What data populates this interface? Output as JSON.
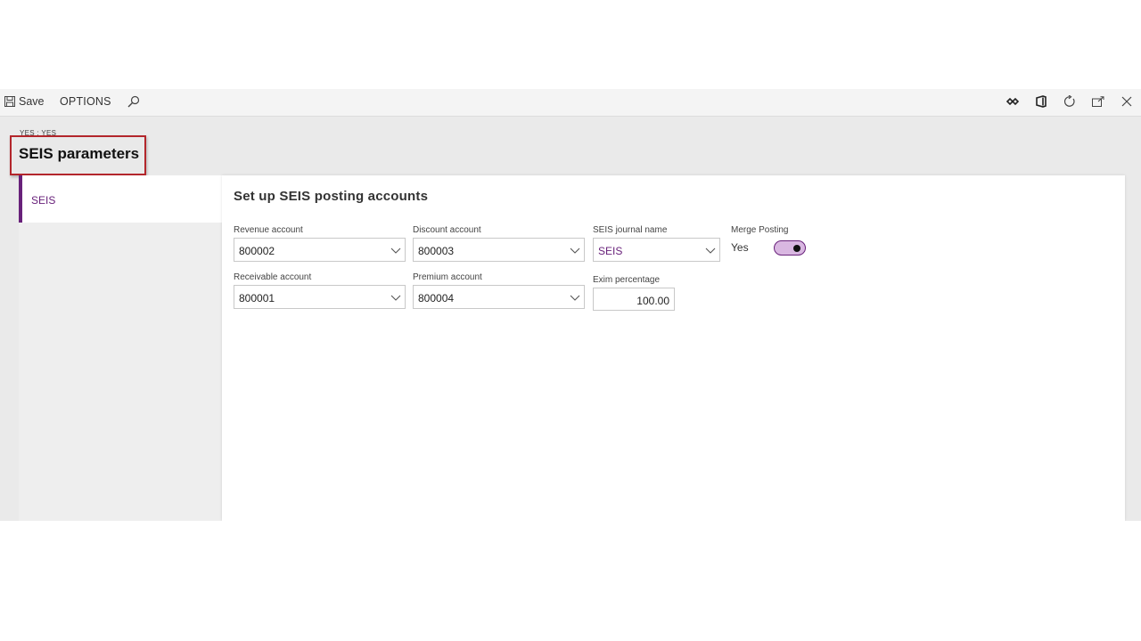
{
  "toolbar": {
    "save_label": "Save",
    "options_label": "OPTIONS",
    "right_icons": [
      "connect-icon",
      "office-icon",
      "refresh-icon",
      "open-new-window-icon",
      "close-icon"
    ]
  },
  "header": {
    "breadcrumb": "YES : YES",
    "title": "SEIS parameters"
  },
  "nav": {
    "items": [
      {
        "label": "SEIS",
        "selected": true
      }
    ]
  },
  "main": {
    "section_title": "Set up SEIS posting accounts",
    "fields": {
      "revenue_account": {
        "label": "Revenue account",
        "value": "800002"
      },
      "discount_account": {
        "label": "Discount account",
        "value": "800003"
      },
      "seis_journal_name": {
        "label": "SEIS journal name",
        "value": "SEIS"
      },
      "merge_posting": {
        "label": "Merge Posting",
        "value": "Yes"
      },
      "receivable_account": {
        "label": "Receivable account",
        "value": "800001"
      },
      "premium_account": {
        "label": "Premium account",
        "value": "800004"
      },
      "exim_percentage": {
        "label": "Exim percentage",
        "value": "100.00"
      }
    }
  },
  "colors": {
    "accent": "#68217a",
    "highlight_border": "#b3262b"
  }
}
